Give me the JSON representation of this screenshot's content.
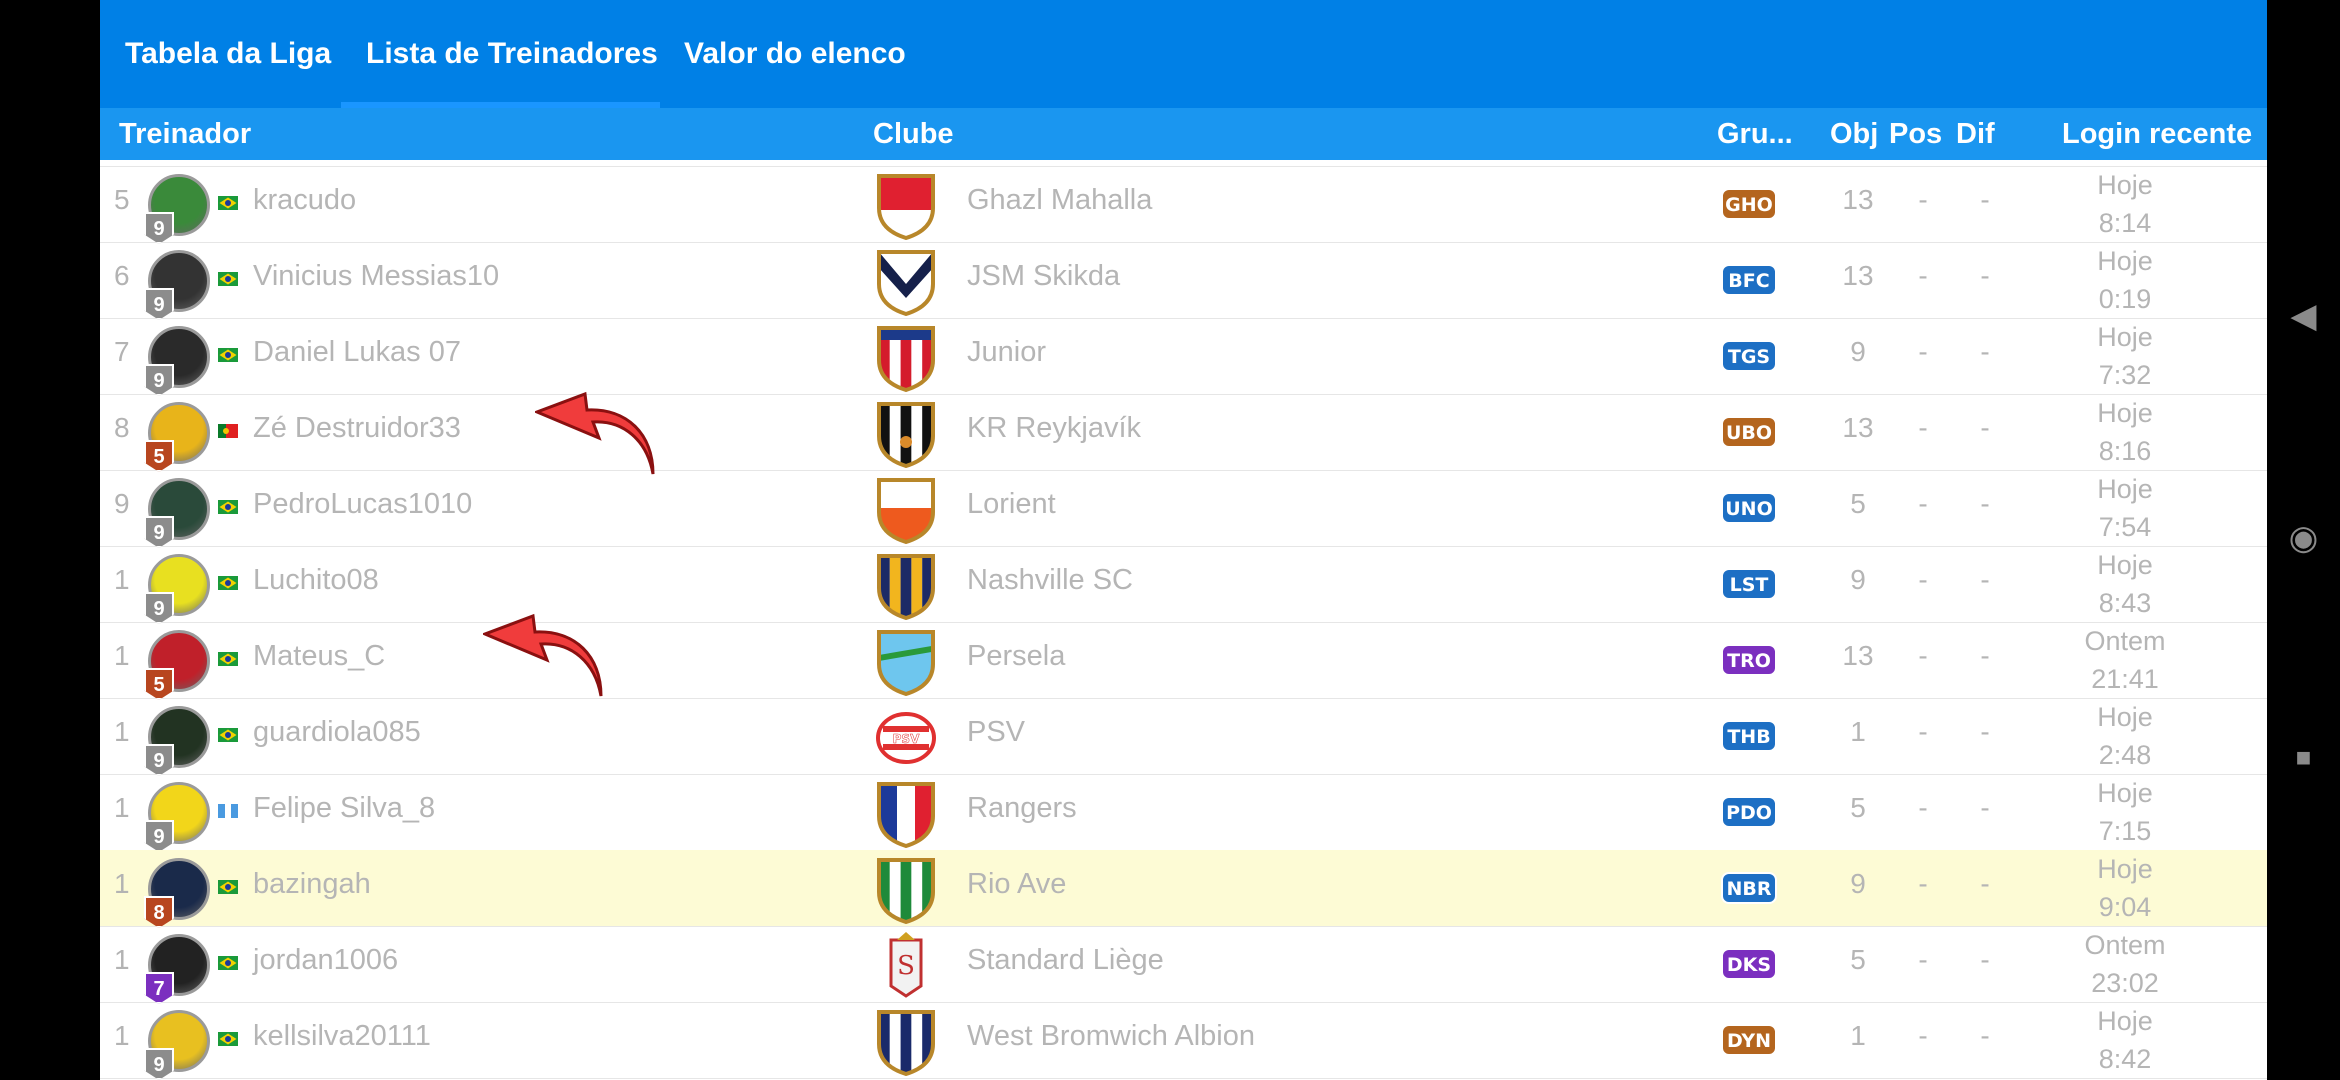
{
  "tabs": [
    {
      "label": "Tabela da Liga"
    },
    {
      "label": "Lista de Treinadores"
    },
    {
      "label": "Valor do elenco"
    }
  ],
  "active_tab_index": 1,
  "columns": {
    "coach": "Treinador",
    "club": "Clube",
    "group": "Gru...",
    "obj": "Obj",
    "pos": "Pos",
    "dif": "Dif",
    "login": "Login recente"
  },
  "rows": [
    {
      "rank": "5",
      "name": "kracudo",
      "level": "9",
      "level_color": "#8c8c8c",
      "flag": "brazil",
      "club": "Ghazl Mahalla",
      "crest": "red-white-shield",
      "group": "GHO",
      "group_color": "#b4651e",
      "obj": "13",
      "pos": "-",
      "dif": "-",
      "login_day": "Hoje",
      "login_time": "8:14",
      "highlight": false
    },
    {
      "rank": "6",
      "name": "Vinicius Messias10",
      "level": "9",
      "level_color": "#8c8c8c",
      "flag": "brazil",
      "club": "JSM Skikda",
      "crest": "navy-chevron-shield",
      "group": "BFC",
      "group_color": "#1d6fc4",
      "obj": "13",
      "pos": "-",
      "dif": "-",
      "login_day": "Hoje",
      "login_time": "0:19",
      "highlight": false
    },
    {
      "rank": "7",
      "name": "Daniel Lukas 07",
      "level": "9",
      "level_color": "#8c8c8c",
      "flag": "brazil",
      "club": "Junior",
      "crest": "red-white-blue-stripes-shield",
      "group": "TGS",
      "group_color": "#1d6fc4",
      "obj": "9",
      "pos": "-",
      "dif": "-",
      "login_day": "Hoje",
      "login_time": "7:32",
      "highlight": false
    },
    {
      "rank": "8",
      "name": "Zé Destruidor33",
      "level": "5",
      "level_color": "#b8461f",
      "flag": "portugal",
      "club": "KR Reykjavík",
      "crest": "black-white-stripes-shield",
      "group": "UBO",
      "group_color": "#b4651e",
      "obj": "13",
      "pos": "-",
      "dif": "-",
      "login_day": "Hoje",
      "login_time": "8:16",
      "highlight": false
    },
    {
      "rank": "9",
      "name": "PedroLucas1010",
      "level": "9",
      "level_color": "#8c8c8c",
      "flag": "brazil",
      "club": "Lorient",
      "crest": "orange-black-shield",
      "group": "UNO",
      "group_color": "#1d6fc4",
      "obj": "5",
      "pos": "-",
      "dif": "-",
      "login_day": "Hoje",
      "login_time": "7:54",
      "highlight": false
    },
    {
      "rank": "1",
      "name": "Luchito08",
      "level": "9",
      "level_color": "#8c8c8c",
      "flag": "brazil",
      "club": "Nashville SC",
      "crest": "navy-gold-stripes-shield",
      "group": "LST",
      "group_color": "#1d6fc4",
      "obj": "9",
      "pos": "-",
      "dif": "-",
      "login_day": "Hoje",
      "login_time": "8:43",
      "highlight": false
    },
    {
      "rank": "1",
      "name": "Mateus_C",
      "level": "5",
      "level_color": "#b8461f",
      "flag": "brazil",
      "club": "Persela",
      "crest": "sky-blue-green-shield",
      "group": "TRO",
      "group_color": "#7b2fbf",
      "obj": "13",
      "pos": "-",
      "dif": "-",
      "login_day": "Ontem",
      "login_time": "21:41",
      "highlight": false
    },
    {
      "rank": "1",
      "name": "guardiola085",
      "level": "9",
      "level_color": "#8c8c8c",
      "flag": "brazil",
      "club": "PSV",
      "crest": "psv-badge",
      "group": "THB",
      "group_color": "#1d6fc4",
      "obj": "1",
      "pos": "-",
      "dif": "-",
      "login_day": "Hoje",
      "login_time": "2:48",
      "highlight": false
    },
    {
      "rank": "1",
      "name": "Felipe Silva_8",
      "level": "9",
      "level_color": "#8c8c8c",
      "flag": "guatemala",
      "club": "Rangers",
      "crest": "blue-red-white-shield",
      "group": "PDO",
      "group_color": "#1d6fc4",
      "obj": "5",
      "pos": "-",
      "dif": "-",
      "login_day": "Hoje",
      "login_time": "7:15",
      "highlight": false
    },
    {
      "rank": "1",
      "name": "bazingah",
      "level": "8",
      "level_color": "#b8461f",
      "flag": "brazil",
      "club": "Rio Ave",
      "crest": "green-white-stripes-shield",
      "group": "NBR",
      "group_color": "#1d6fc4",
      "obj": "9",
      "pos": "-",
      "dif": "-",
      "login_day": "Hoje",
      "login_time": "9:04",
      "highlight": true
    },
    {
      "rank": "1",
      "name": "jordan1006",
      "level": "7",
      "level_color": "#7b2fbf",
      "flag": "brazil",
      "club": "Standard Liège",
      "crest": "standard-liege-badge",
      "group": "DKS",
      "group_color": "#7b2fbf",
      "obj": "5",
      "pos": "-",
      "dif": "-",
      "login_day": "Ontem",
      "login_time": "23:02",
      "highlight": false
    },
    {
      "rank": "1",
      "name": "kellsilva20111",
      "level": "9",
      "level_color": "#8c8c8c",
      "flag": "brazil",
      "club": "West Bromwich Albion",
      "crest": "navy-white-stripes-shield",
      "group": "DYN",
      "group_color": "#b4651e",
      "obj": "1",
      "pos": "-",
      "dif": "-",
      "login_day": "Hoje",
      "login_time": "8:42",
      "highlight": false
    }
  ],
  "annotations": [
    "red-arrow",
    "red-arrow"
  ],
  "system_nav": [
    {
      "icon": "back-triangle-icon",
      "glyph": "◀"
    },
    {
      "icon": "home-circle-icon",
      "glyph": "◉"
    },
    {
      "icon": "recents-square-icon",
      "glyph": "■"
    }
  ]
}
